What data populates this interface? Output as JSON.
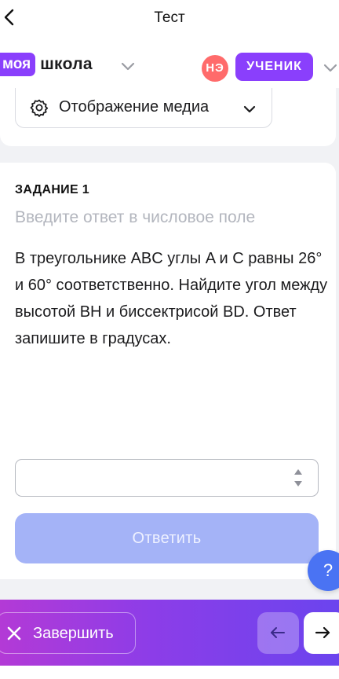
{
  "topbar": {
    "title": "Тест"
  },
  "appbar": {
    "logo_badge": "моя",
    "logo_text": "школа",
    "avatar_initials": "НЭ",
    "role": "УЧЕНИК"
  },
  "media": {
    "label": "Отображение медиа"
  },
  "task": {
    "title": "ЗАДАНИЕ 1",
    "hint": "Введите ответ в числовое поле",
    "text": "В треугольнике ABC углы A и C равны 26° и 60° соответственно. Найдите угол между высотой BH и биссектрисой BD. Ответ запишите в градусах.",
    "answer_value": "",
    "submit_label": "Ответить"
  },
  "help": {
    "label": "?"
  },
  "footer": {
    "finish_label": "Завершить"
  },
  "colors": {
    "accent": "#8a3ffc",
    "avatar": "#ff6b6b",
    "submit_disabled": "#a4b3f7",
    "help": "#4a73f3",
    "footer_gradient_start": "#b33ad6",
    "footer_gradient_end": "#6b44ee"
  },
  "icons": {
    "back": "chevron-left-icon",
    "logo_dropdown": "chevron-down-icon",
    "role_dropdown": "chevron-down-icon",
    "media": "gear-icon",
    "media_dropdown": "chevron-down-icon",
    "spinner": "spinner-icon",
    "finish": "close-icon",
    "prev": "arrow-left-icon",
    "next": "arrow-right-icon"
  }
}
